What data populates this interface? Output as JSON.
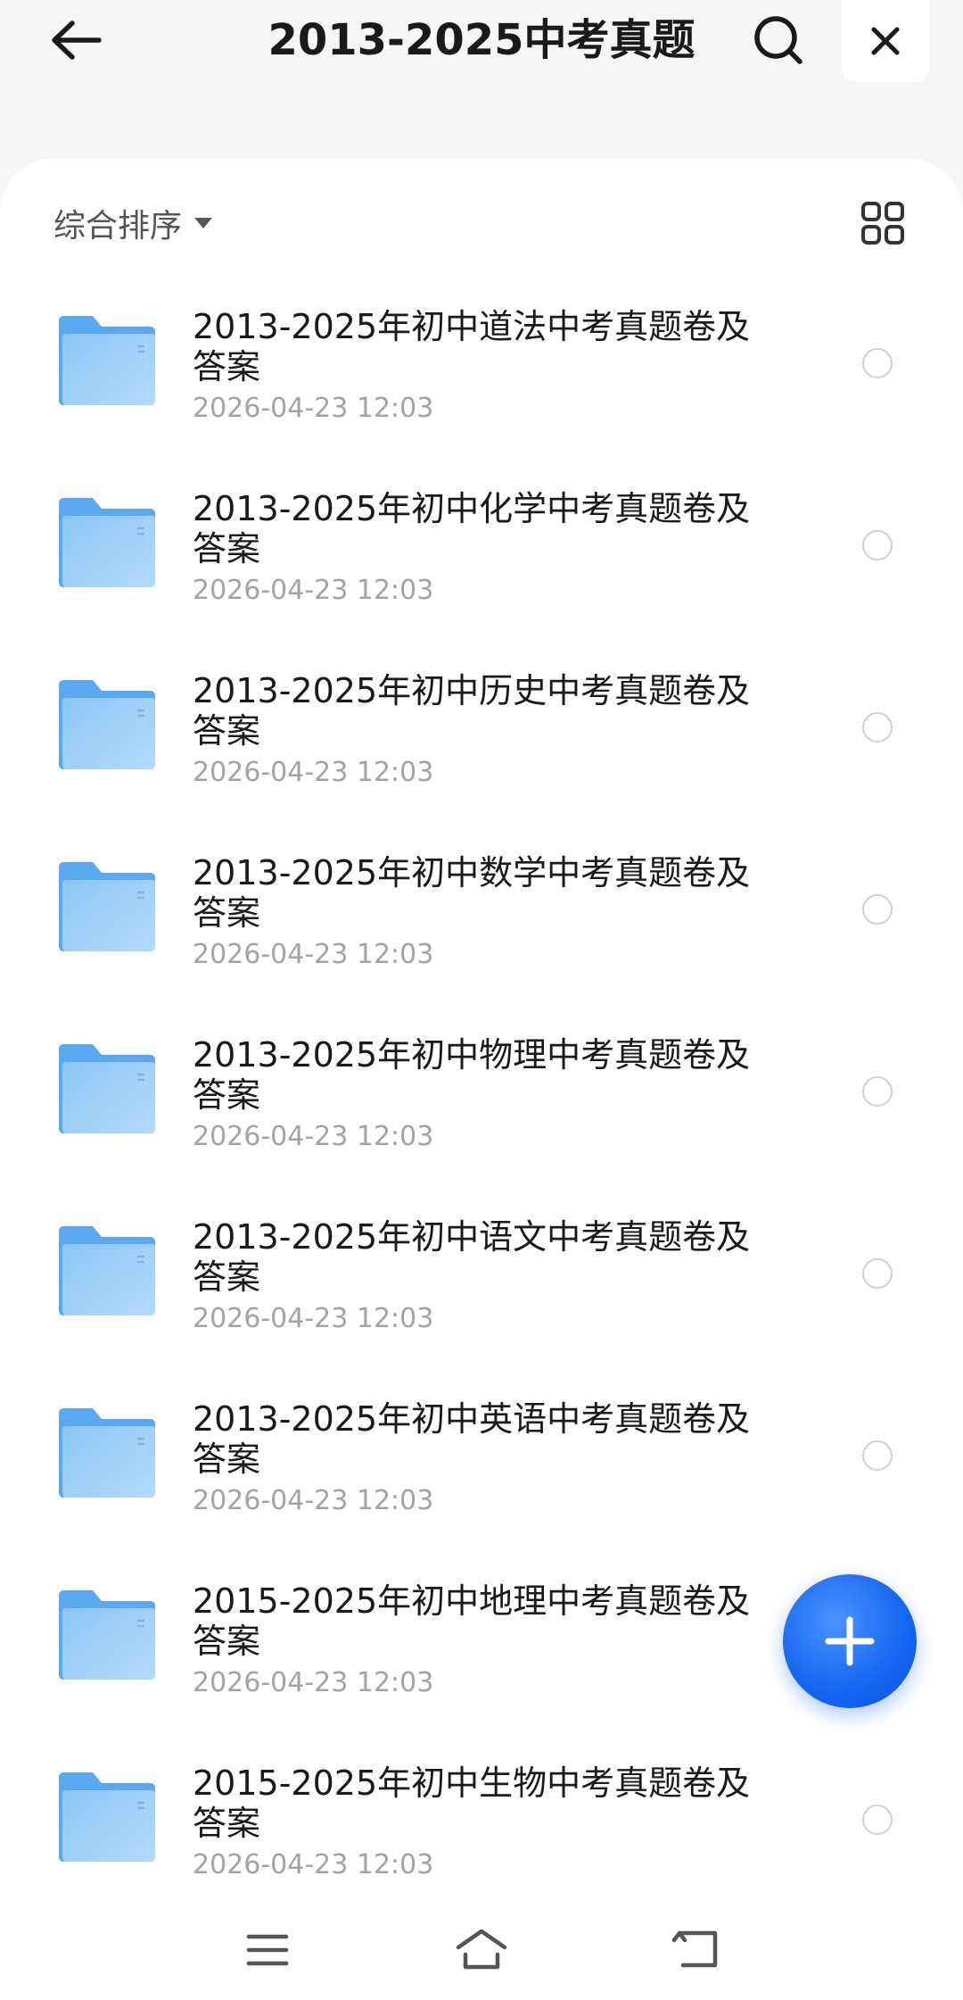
{
  "header": {
    "title": "2013-2025中考真题",
    "back_icon": "arrow-left-icon",
    "search_icon": "search-icon",
    "close_icon": "close-icon"
  },
  "toolbar": {
    "sort_label": "综合排序",
    "view_icon": "grid-view-icon"
  },
  "files": [
    {
      "name": "2013-2025年初中道法中考真题卷及答案",
      "date": "2026-04-23 12:03"
    },
    {
      "name": "2013-2025年初中化学中考真题卷及答案",
      "date": "2026-04-23 12:03"
    },
    {
      "name": "2013-2025年初中历史中考真题卷及答案",
      "date": "2026-04-23 12:03"
    },
    {
      "name": "2013-2025年初中数学中考真题卷及答案",
      "date": "2026-04-23 12:03"
    },
    {
      "name": "2013-2025年初中物理中考真题卷及答案",
      "date": "2026-04-23 12:03"
    },
    {
      "name": "2013-2025年初中语文中考真题卷及答案",
      "date": "2026-04-23 12:03"
    },
    {
      "name": "2013-2025年初中英语中考真题卷及答案",
      "date": "2026-04-23 12:03"
    },
    {
      "name": "2015-2025年初中地理中考真题卷及答案",
      "date": "2026-04-23 12:03"
    },
    {
      "name": "2015-2025年初中生物中考真题卷及答案",
      "date": "2026-04-23 12:03"
    }
  ],
  "fab": {
    "icon": "plus-icon"
  },
  "navbar": {
    "icons": [
      "menu-icon",
      "home-icon",
      "back-nav-icon"
    ]
  },
  "colors": {
    "accent": "#1565f0",
    "folder": "#72b4f3",
    "date_text": "#a3a3a3"
  }
}
